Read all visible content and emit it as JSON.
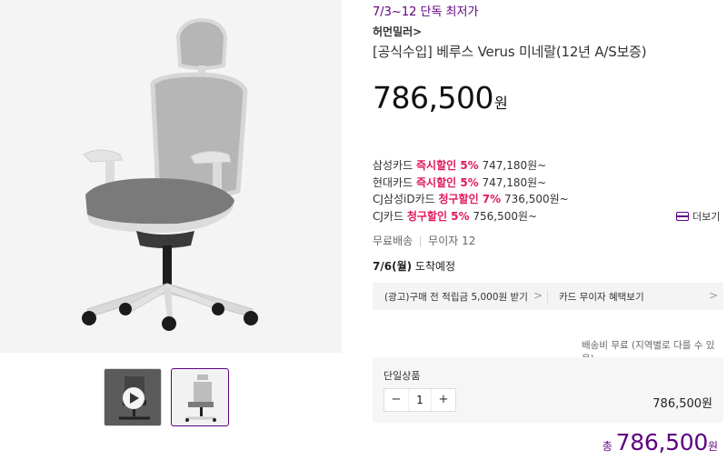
{
  "gallery": {
    "main_image": "office-mesh-chair-photo",
    "thumbnails": [
      {
        "kind": "video",
        "icon": "play-icon"
      },
      {
        "kind": "image",
        "selected": true
      }
    ]
  },
  "product": {
    "promo": "7/3~12 단독 최저가",
    "brand": "허먼밀러",
    "brand_chevron": ">",
    "title": "[공식수입] 베루스 Verus 미네랄(12년 A/S보증)",
    "price": "786,500",
    "price_unit": "원"
  },
  "card_discounts": [
    {
      "card": "삼성카드 ",
      "tag": "즉시할인 5%",
      "price": " 747,180원~"
    },
    {
      "card": "현대카드 ",
      "tag": "즉시할인 5%",
      "price": " 747,180원~"
    },
    {
      "card": "CJ삼성iD카드 ",
      "tag": "청구할인 7%",
      "price": " 736,500원~"
    },
    {
      "card": "CJ카드 ",
      "tag": "청구할인 5%",
      "price": " 756,500원~"
    }
  ],
  "more_label": "더보기",
  "shipping": {
    "free": "무료배송",
    "installment": "무이자 12",
    "arrival_date": "7/6(월)",
    "arrival_text": " 도착예정",
    "fee_note": "배송비 무료 (지역별로 다를 수 있음)"
  },
  "benefits": {
    "left": "(광고)구매 전 적립금 5,000원 받기",
    "right": "카드 무이자 혜택보기",
    "chevron": ">"
  },
  "option": {
    "name": "단일상품",
    "minus": "−",
    "qty": "1",
    "plus": "+",
    "price": "786,500원"
  },
  "total": {
    "label": "총 ",
    "value": "786,500",
    "unit": "원"
  },
  "colors": {
    "accent": "#5f0080",
    "discount": "#e0195a"
  }
}
